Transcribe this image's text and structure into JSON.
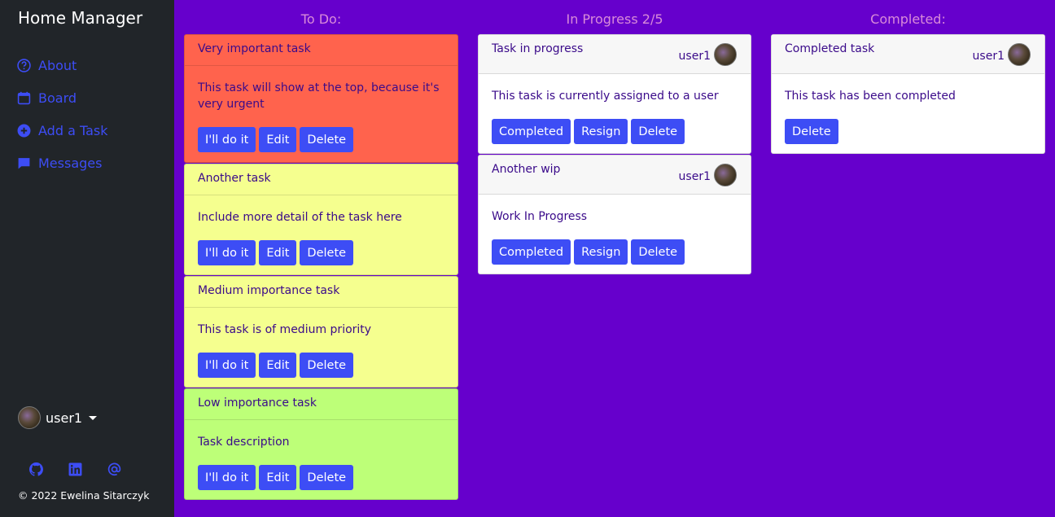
{
  "app": {
    "title": "Home Manager"
  },
  "nav": [
    {
      "label": "About",
      "icon": "question-circle-icon"
    },
    {
      "label": "Board",
      "icon": "calendar-icon"
    },
    {
      "label": "Add a Task",
      "icon": "plus-circle-icon"
    },
    {
      "label": "Messages",
      "icon": "chat-icon"
    }
  ],
  "user": {
    "name": "user1"
  },
  "socials": [
    "github-icon",
    "linkedin-icon",
    "at-sign-icon"
  ],
  "footer": {
    "copyright": "© 2022 Ewelina Sitarczyk"
  },
  "colors": {
    "background": "#6600cc",
    "sidebar": "#212529",
    "accent": "#3d4df5",
    "urgent": "#ff634d",
    "medium": "#f5ff8f",
    "low": "#bdff78"
  },
  "columns": {
    "todo": {
      "title": "To Do:",
      "cards": [
        {
          "title": "Very important task",
          "text": "This task will show at the top, because it's very urgent",
          "priority": "urgent",
          "buttons": [
            "I'll do it",
            "Edit",
            "Delete"
          ]
        },
        {
          "title": "Another task",
          "text": "Include more detail of the task here",
          "priority": "medium",
          "buttons": [
            "I'll do it",
            "Edit",
            "Delete"
          ]
        },
        {
          "title": "Medium importance task",
          "text": "This task is of medium priority",
          "priority": "medium",
          "buttons": [
            "I'll do it",
            "Edit",
            "Delete"
          ]
        },
        {
          "title": "Low importance task",
          "text": "Task description",
          "priority": "low",
          "buttons": [
            "I'll do it",
            "Edit",
            "Delete"
          ]
        }
      ]
    },
    "progress": {
      "title": "In Progress 2/5",
      "cards": [
        {
          "title": "Task in progress",
          "user": "user1",
          "text": "This task is currently assigned to a user",
          "buttons": [
            "Completed",
            "Resign",
            "Delete"
          ]
        },
        {
          "title": "Another wip",
          "user": "user1",
          "text": "Work In Progress",
          "buttons": [
            "Completed",
            "Resign",
            "Delete"
          ]
        }
      ]
    },
    "completed": {
      "title": "Completed:",
      "cards": [
        {
          "title": "Completed task",
          "user": "user1",
          "text": "This task has been completed",
          "buttons": [
            "Delete"
          ]
        }
      ]
    }
  }
}
